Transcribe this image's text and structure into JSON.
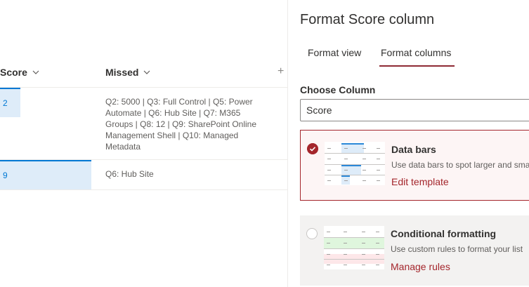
{
  "list": {
    "columns": [
      {
        "label": "Score"
      },
      {
        "label": "Missed"
      }
    ],
    "add_column_glyph": "+",
    "rows": [
      {
        "score": "2",
        "score_fraction": 0.2,
        "missed_lines": [
          "Q2: 5000 | Q3: Full Control | Q5: Power",
          "Automate | Q6: Hub Site | Q7: M365",
          "Groups | Q8: 12 | Q9: SharePoint Online",
          "Management Shell | Q10: Managed",
          "Metadata"
        ]
      },
      {
        "score": "9",
        "score_fraction": 0.9,
        "missed_lines": [
          "Q6: Hub Site"
        ]
      }
    ]
  },
  "panel": {
    "title": "Format Score column",
    "tabs": [
      {
        "label": "Format view",
        "active": false
      },
      {
        "label": "Format columns",
        "active": true
      }
    ],
    "choose_label": "Choose Column",
    "selected_column": "Score",
    "options": [
      {
        "title": "Data bars",
        "description": "Use data bars to spot larger and smal",
        "link": "Edit template",
        "selected": true
      },
      {
        "title": "Conditional formatting",
        "description": "Use custom rules to format your list",
        "link": "Manage rules",
        "selected": false
      }
    ]
  },
  "colors": {
    "accent": "#a4262c",
    "tab_underline": "#8e2a34",
    "databar_fill": "#deecf9",
    "databar_edge": "#0078d4",
    "row_green": "#dff6dd",
    "row_red": "#fde7e9"
  },
  "icons": {
    "sort": "chevron-down-icon",
    "add_column": "plus-icon",
    "selected": "checkmark-circle-icon"
  }
}
